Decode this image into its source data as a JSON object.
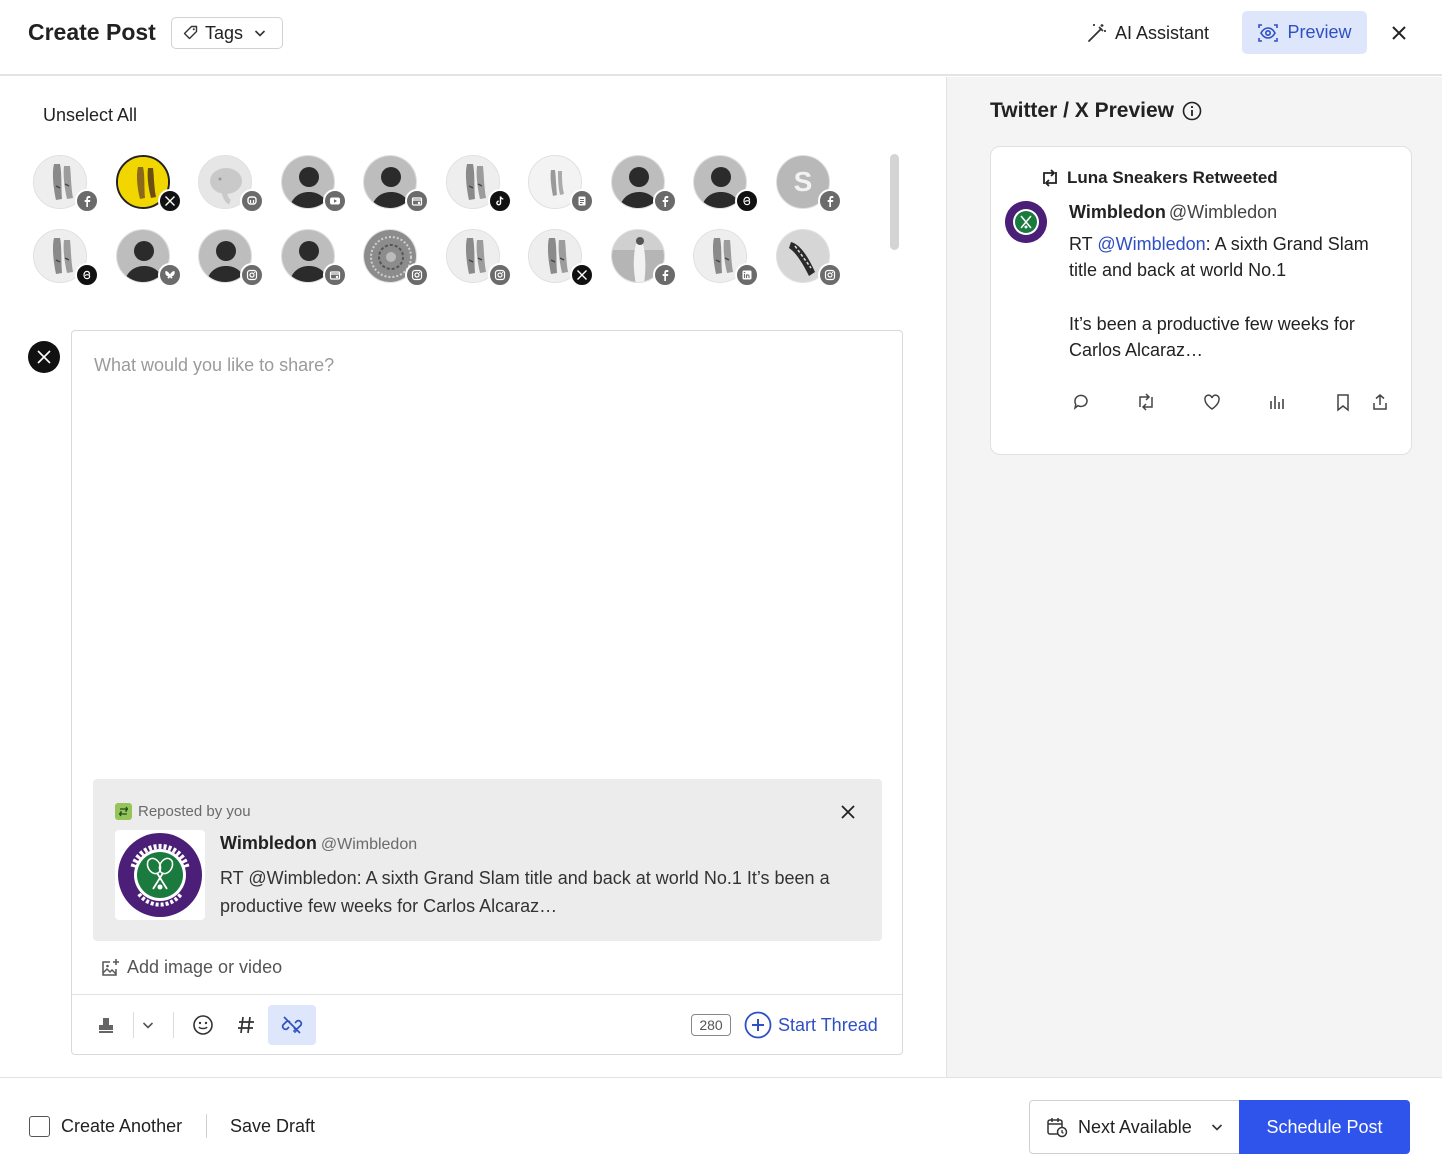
{
  "header": {
    "title": "Create Post",
    "tags_label": "Tags",
    "ai_assistant_label": "AI Assistant",
    "preview_label": "Preview"
  },
  "accounts": {
    "unselect_all_label": "Unselect All",
    "items": [
      {
        "kind": "sneaker",
        "network": "facebook",
        "selected": false
      },
      {
        "kind": "sneaker-yellow",
        "network": "x",
        "selected": true
      },
      {
        "kind": "elephant",
        "network": "mastodon",
        "selected": false
      },
      {
        "kind": "person",
        "network": "youtube",
        "selected": false
      },
      {
        "kind": "person",
        "network": "google-business",
        "selected": false
      },
      {
        "kind": "sneaker",
        "network": "tiktok",
        "selected": false
      },
      {
        "kind": "sneaker-small",
        "network": "document",
        "selected": false
      },
      {
        "kind": "person",
        "network": "facebook",
        "selected": false
      },
      {
        "kind": "person",
        "network": "threads",
        "selected": false
      },
      {
        "kind": "letter",
        "letter": "S",
        "network": "facebook",
        "selected": false
      },
      {
        "kind": "sneaker",
        "network": "threads",
        "selected": false
      },
      {
        "kind": "person",
        "network": "bluesky",
        "selected": false
      },
      {
        "kind": "person",
        "network": "instagram",
        "selected": false
      },
      {
        "kind": "person",
        "network": "google-business",
        "selected": false
      },
      {
        "kind": "mandala",
        "network": "instagram",
        "selected": false
      },
      {
        "kind": "sneaker",
        "network": "instagram",
        "selected": false
      },
      {
        "kind": "sneaker",
        "network": "x",
        "selected": false
      },
      {
        "kind": "photo",
        "network": "facebook",
        "selected": false
      },
      {
        "kind": "sneaker",
        "network": "linkedin",
        "selected": false
      },
      {
        "kind": "shoe-dark",
        "network": "instagram",
        "selected": false
      }
    ]
  },
  "composer": {
    "placeholder": "What would you like to share?",
    "repost": {
      "label": "Reposted by you",
      "name": "Wimbledon",
      "handle": "@Wimbledon",
      "text": "RT @Wimbledon: A sixth Grand Slam title and back at world No.1 It’s been a productive few weeks for Carlos Alcaraz…",
      "logo_text": "THE CHAMPIONSHIPS WIMBLEDON"
    },
    "add_media_label": "Add image or video",
    "char_count": "280",
    "start_thread_label": "Start Thread"
  },
  "preview": {
    "title": "Twitter / X Preview",
    "retweeted_by": "Luna Sneakers Retweeted",
    "name": "Wimbledon",
    "handle": "@Wimbledon",
    "text_prefix": "RT ",
    "mention": "@Wimbledon",
    "text_line1_rest": ": A sixth Grand Slam title and back at world No.1",
    "text_line2": "It’s been a productive few weeks for Carlos Alcaraz…"
  },
  "footer": {
    "create_another_label": "Create Another",
    "save_draft_label": "Save Draft",
    "schedule_option_label": "Next Available",
    "schedule_button_label": "Schedule Post"
  },
  "colors": {
    "accent": "#2f54eb",
    "preview_bg": "#dde6fb",
    "repost_green": "#97c45a",
    "wimbledon_purple": "#4b1e78",
    "wimbledon_green": "#1b7a3e"
  }
}
